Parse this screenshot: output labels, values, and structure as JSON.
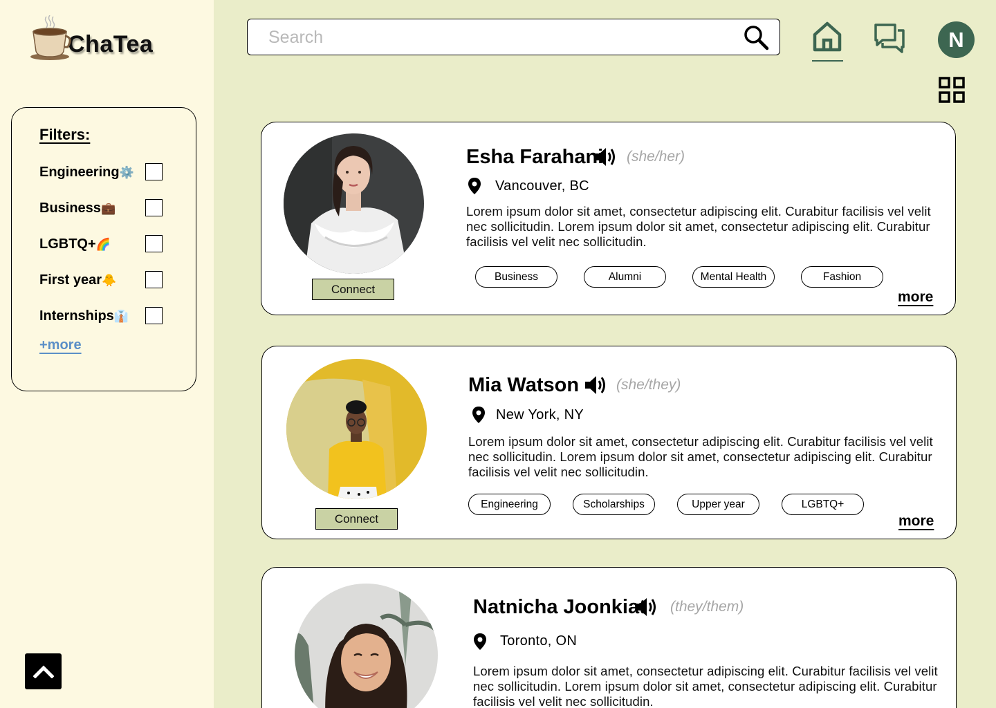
{
  "app": {
    "name": "ChaTea"
  },
  "sidebar": {
    "filters_title": "Filters:",
    "filters": [
      {
        "label": "Engineering",
        "emoji": "⚙️",
        "checked": false
      },
      {
        "label": "Business",
        "emoji": "💼",
        "checked": false
      },
      {
        "label": "LGBTQ+",
        "emoji": "🌈",
        "checked": false
      },
      {
        "label": "First year",
        "emoji": "🐥",
        "checked": false
      },
      {
        "label": "Internships",
        "emoji": "👔",
        "checked": false
      }
    ],
    "more_label": "+more"
  },
  "header": {
    "search_placeholder": "Search",
    "avatar_initial": "N"
  },
  "profiles": [
    {
      "name": "Esha Farahani",
      "pronouns": "(she/her)",
      "location": "Vancouver, BC",
      "bio": "Lorem ipsum dolor sit amet, consectetur adipiscing elit. Curabitur facilisis vel velit nec sollicitudin. Lorem ipsum dolor sit amet, consectetur adipiscing elit. Curabitur facilisis vel velit nec sollicitudin.",
      "tags": [
        "Business",
        "Alumni",
        "Mental Health",
        "Fashion"
      ],
      "connect_label": "Connect",
      "more_label": "more"
    },
    {
      "name": "Mia Watson",
      "pronouns": "(she/they)",
      "location": "New York, NY",
      "bio": "Lorem ipsum dolor sit amet, consectetur adipiscing elit. Curabitur facilisis vel velit nec sollicitudin. Lorem ipsum dolor sit amet, consectetur adipiscing elit. Curabitur facilisis vel velit nec sollicitudin.",
      "tags": [
        "Engineering",
        "Scholarships",
        "Upper year",
        "LGBTQ+"
      ],
      "connect_label": "Connect",
      "more_label": "more"
    },
    {
      "name": "Natnicha Joonkiat",
      "pronouns": "(they/them)",
      "location": "Toronto, ON",
      "bio": "Lorem ipsum dolor sit amet, consectetur adipiscing elit. Curabitur facilisis vel velit nec sollicitudin. Lorem ipsum dolor sit amet, consectetur adipiscing elit. Curabitur facilisis vel velit nec sollicitudin."
    }
  ],
  "colors": {
    "page_bg": "#eaedc9",
    "sidebar_bg": "#fdf9e1",
    "accent_green": "#3d6651",
    "connect_bg": "#c9d2a4",
    "link_blue": "#5b8fc7"
  }
}
